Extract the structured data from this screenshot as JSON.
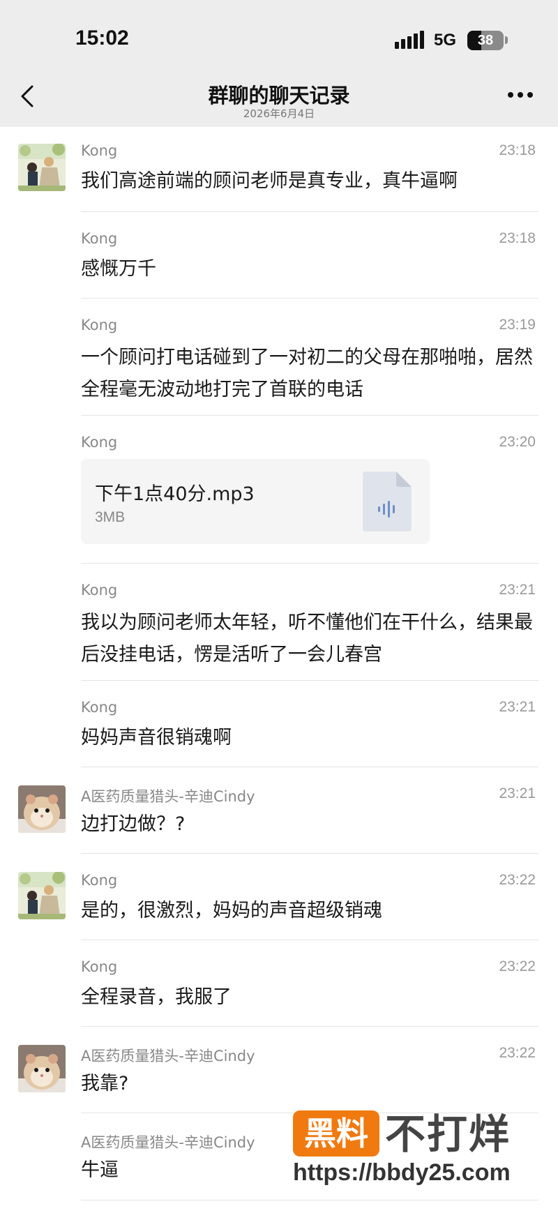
{
  "status_bar": {
    "time": "15:02",
    "network": "5G",
    "battery": "38",
    "battery_level_percent": 38
  },
  "header": {
    "title": "群聊的聊天记录",
    "date": "2026年6月4日",
    "back_icon": "chevron-left-icon",
    "more_icon": "more-dots-icon"
  },
  "messages": [
    {
      "sender": "Kong",
      "time": "23:18",
      "text": "我们高途前端的顾问老师是真专业，真牛逼啊",
      "avatar": "avatar-kong"
    },
    {
      "sender": "Kong",
      "time": "23:18",
      "text": "感慨万千"
    },
    {
      "sender": "Kong",
      "time": "23:19",
      "text": "一个顾问打电话碰到了一对初二的父母在那啪啪，居然全程毫无波动地打完了首联的电话"
    },
    {
      "sender": "Kong",
      "time": "23:20",
      "file": {
        "name": "下午1点40分.mp3",
        "size": "3MB",
        "icon": "audio-file-icon"
      }
    },
    {
      "sender": "Kong",
      "time": "23:21",
      "text": "我以为顾问老师太年轻，听不懂他们在干什么，结果最后没挂电话，愣是活听了一会儿春宫"
    },
    {
      "sender": "Kong",
      "time": "23:21",
      "text": "妈妈声音很销魂啊"
    },
    {
      "sender": "A医药质量猎头-辛迪Cindy",
      "time": "23:21",
      "text": "边打边做？?",
      "avatar": "avatar-cindy"
    },
    {
      "sender": "Kong",
      "time": "23:22",
      "text": "是的，很激烈，妈妈的声音超级销魂",
      "avatar": "avatar-kong"
    },
    {
      "sender": "Kong",
      "time": "23:22",
      "text": "全程录音，我服了"
    },
    {
      "sender": "A医药质量猎头-辛迪Cindy",
      "time": "23:22",
      "text": "我靠?",
      "avatar": "avatar-cindy"
    },
    {
      "sender": "A医药质量猎头-辛迪Cindy",
      "time": "",
      "text": "牛逼"
    }
  ],
  "watermark": {
    "badge": "黑料",
    "text": "不打烊",
    "url": "https://bbdy25.com"
  },
  "colors": {
    "header_bg": "#ededed",
    "divider": "#e4e4e4",
    "watermark_orange": "#f07a10"
  }
}
